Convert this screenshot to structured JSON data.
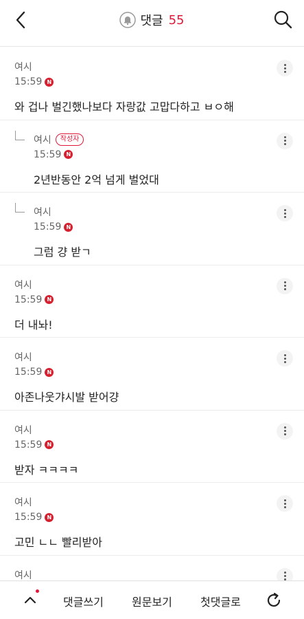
{
  "header": {
    "title": "댓글",
    "count": "55",
    "back_icon": "chevron-left-icon",
    "search_icon": "search-icon",
    "bell_icon": "bell-icon"
  },
  "comments": [
    {
      "author": "여시",
      "time": "15:59",
      "badge": "N",
      "text": "와 겁나 벌긴했나보다 자랑값 고맙다하고 ㅂㅇ해",
      "reply": false,
      "op": ""
    },
    {
      "author": "여시",
      "time": "15:59",
      "badge": "N",
      "text": "2년반동안 2억 넘게 벌었대",
      "reply": true,
      "op": "작성자"
    },
    {
      "author": "여시",
      "time": "15:59",
      "badge": "N",
      "text": "그럼 걍 받ㄱ",
      "reply": true,
      "op": ""
    },
    {
      "author": "여시",
      "time": "15:59",
      "badge": "N",
      "text": "더 내놔!",
      "reply": false,
      "op": ""
    },
    {
      "author": "여시",
      "time": "15:59",
      "badge": "N",
      "text": "아존나웃갸시발 받어걍",
      "reply": false,
      "op": ""
    },
    {
      "author": "여시",
      "time": "15:59",
      "badge": "N",
      "text": "받자 ㅋㅋㅋㅋ",
      "reply": false,
      "op": ""
    },
    {
      "author": "여시",
      "time": "15:59",
      "badge": "N",
      "text": "고민 ㄴㄴ 빨리받아",
      "reply": false,
      "op": ""
    },
    {
      "author": "여시",
      "time": "",
      "badge": "",
      "text": "",
      "reply": false,
      "op": ""
    }
  ],
  "bottom_bar": {
    "write_label": "댓글쓰기",
    "original_label": "원문보기",
    "first_label": "첫댓글로",
    "up_icon": "chevron-up-icon",
    "refresh_icon": "refresh-icon"
  },
  "colors": {
    "accent": "#e0193a",
    "new_badge": "#d6202f"
  }
}
